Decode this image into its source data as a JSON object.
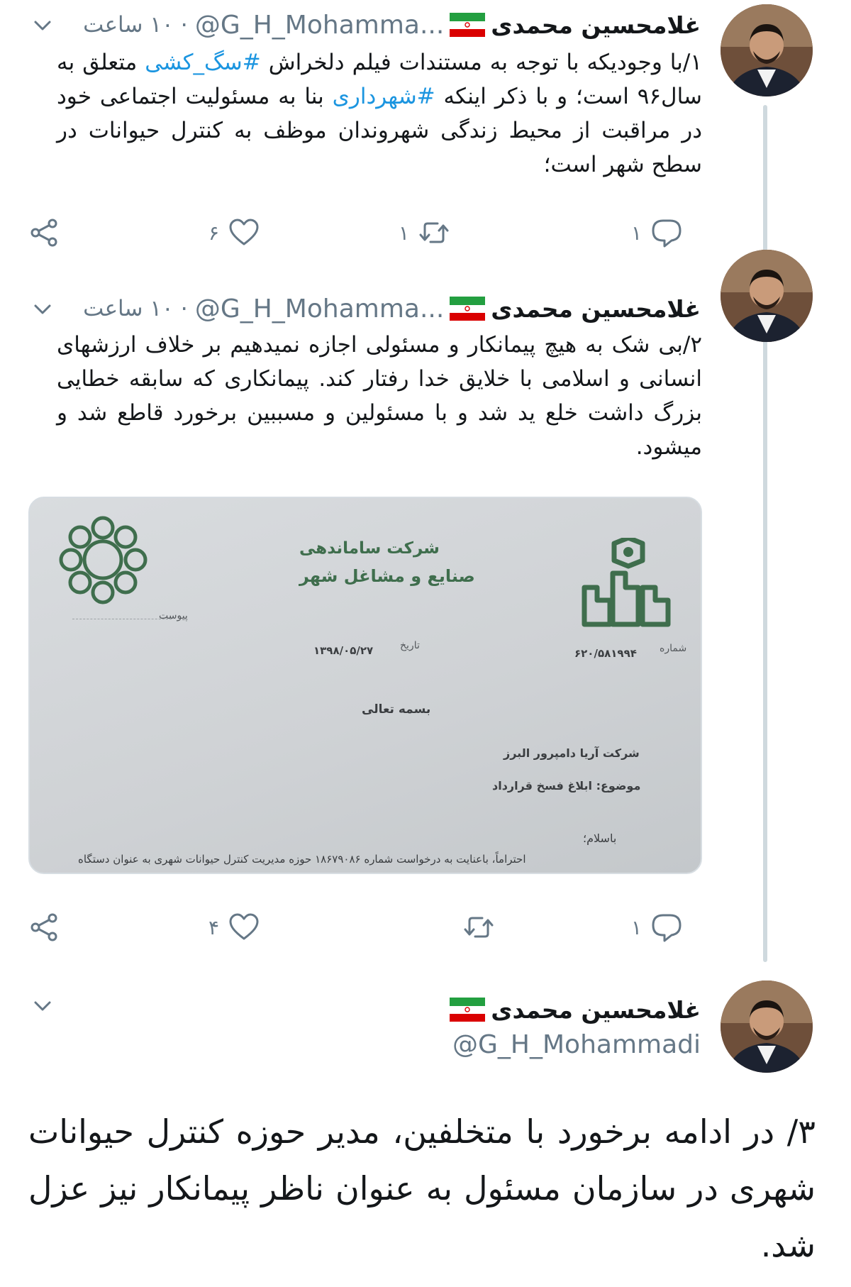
{
  "tweets": [
    {
      "author": "غلامحسین محمدی",
      "handle": "@G_H_Mohamma...",
      "separator": "·",
      "time": "۱۰ ساعت",
      "text_parts": [
        "۱/با وجودیکه با توجه به مستندات فیلم دلخراش ",
        "#سگ_کشی",
        " متعلق به سال۹۶ است؛ و با ذکر اینکه ",
        "#شهرداری",
        " بنا به مسئولیت اجتماعی خود در مراقبت از محیط زندگی شهروندان موظف به کنترل حیوانات در سطح شهر است؛"
      ],
      "actions": {
        "reply_count": "۱",
        "retweet_count": "۱",
        "like_count": "۶"
      }
    },
    {
      "author": "غلامحسین محمدی",
      "handle": "@G_H_Mohamma...",
      "separator": "·",
      "time": "۱۰ ساعت",
      "text": "۲/بی شک به هیچ پیمانکار و مسئولی اجازه نمیدهیم بر خلاف ارزشهای انسانی و اسلامی با خلایق خدا رفتار کند. پیمانکاری که سابقه خطایی بزرگ داشت خلع ید شد و با مسئولین و مسببین برخورد قاطع شد و میشود.",
      "actions": {
        "reply_count": "۱",
        "retweet_count": "",
        "like_count": "۴"
      },
      "media": {
        "company_line_1": "شرکت ساماندهی",
        "company_line_2": "صنایع و مشاغل شهر",
        "number_label": "شماره",
        "number_value": "۶۲۰/۵۸۱۹۹۴",
        "date_label": "تاریخ",
        "date_value": "۱۳۹۸/۰۵/۲۷",
        "attachment_label": "پیوست",
        "bismillah": "بسمه تعالی",
        "recipient": "شرکت آریا دامپرور البرز",
        "subject": "موضوع: ابلاغ فسخ قرارداد",
        "greeting": "باسلام؛",
        "body": "احتراماً، باعنایت به درخواست شماره ۱۸۶۷۹۰۸۶ حوزه مدیریت کنترل حیوانات شهری به عنوان دستگاه"
      }
    },
    {
      "author": "غلامحسین محمدی",
      "handle": "@G_H_Mohammadi",
      "text": "۳/ در ادامه برخورد با متخلفین، مدیر حوزه کنترل حیوانات شهری در سازمان مسئول به عنوان ناظر پیمانکار نیز عزل شد."
    }
  ],
  "colors": {
    "hashtag": "#1b95e0",
    "meta": "#657786",
    "thread_line": "#cfd9de",
    "text": "#14171a"
  },
  "icons": [
    "chevron-down-icon",
    "iran-flag-icon",
    "reply-icon",
    "retweet-icon",
    "like-icon",
    "share-icon",
    "tehran-municipality-logo",
    "samandehi-logo"
  ]
}
